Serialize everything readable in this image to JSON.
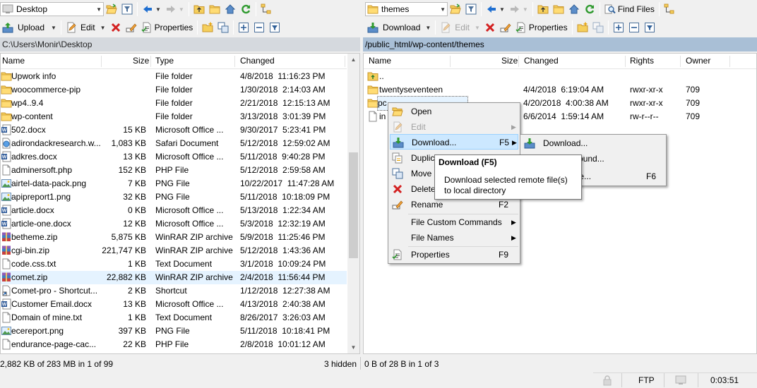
{
  "left": {
    "location": "Desktop",
    "toolbar": {
      "upload": "Upload",
      "edit": "Edit",
      "properties": "Properties"
    },
    "path": "C:\\Users\\Monir\\Desktop",
    "columns": {
      "name": "Name",
      "size": "Size",
      "type": "Type",
      "changed": "Changed"
    },
    "files": [
      {
        "icon": "folder-icon",
        "name": "Upwork info",
        "size": "",
        "type": "File folder",
        "changed": "4/8/2018  11:16:23 PM"
      },
      {
        "icon": "folder-icon",
        "name": "woocommerce-pip",
        "size": "",
        "type": "File folder",
        "changed": "1/30/2018  2:14:03 AM"
      },
      {
        "icon": "folder-icon",
        "name": "wp4..9.4",
        "size": "",
        "type": "File folder",
        "changed": "2/21/2018  12:15:13 AM"
      },
      {
        "icon": "folder-icon",
        "name": "wp-content",
        "size": "",
        "type": "File folder",
        "changed": "3/13/2018  3:01:39 PM"
      },
      {
        "icon": "word-doc-icon",
        "name": "502.docx",
        "size": "15 KB",
        "type": "Microsoft Office ...",
        "changed": "9/30/2017  5:23:41 PM"
      },
      {
        "icon": "webloc-icon",
        "name": "adirondackresearch.w...",
        "size": "1,083 KB",
        "type": "Safari Document",
        "changed": "5/12/2018  12:59:02 AM"
      },
      {
        "icon": "word-doc-icon",
        "name": "adkres.docx",
        "size": "13 KB",
        "type": "Microsoft Office ...",
        "changed": "5/11/2018  9:40:28 PM"
      },
      {
        "icon": "file-icon",
        "name": "adminersoft.php",
        "size": "152 KB",
        "type": "PHP File",
        "changed": "5/12/2018  2:59:58 AM"
      },
      {
        "icon": "image-icon",
        "name": "airtel-data-pack.png",
        "size": "7 KB",
        "type": "PNG File",
        "changed": "10/22/2017  11:47:28 AM"
      },
      {
        "icon": "image-icon",
        "name": "apipreport1.png",
        "size": "32 KB",
        "type": "PNG File",
        "changed": "5/11/2018  10:18:09 PM"
      },
      {
        "icon": "word-doc-icon",
        "name": "article.docx",
        "size": "0 KB",
        "type": "Microsoft Office ...",
        "changed": "5/13/2018  1:22:34 AM"
      },
      {
        "icon": "word-doc-icon",
        "name": "article-one.docx",
        "size": "12 KB",
        "type": "Microsoft Office ...",
        "changed": "5/3/2018  12:32:19 AM"
      },
      {
        "icon": "archive-icon",
        "name": "betheme.zip",
        "size": "5,875 KB",
        "type": "WinRAR ZIP archive",
        "changed": "5/9/2018  11:25:46 PM"
      },
      {
        "icon": "archive-icon",
        "name": "cgi-bin.zip",
        "size": "221,747 KB",
        "type": "WinRAR ZIP archive",
        "changed": "5/12/2018  1:43:36 AM"
      },
      {
        "icon": "file-icon",
        "name": "code.css.txt",
        "size": "1 KB",
        "type": "Text Document",
        "changed": "3/1/2018  10:09:24 PM"
      },
      {
        "icon": "archive-icon",
        "name": "comet.zip",
        "size": "22,882 KB",
        "type": "WinRAR ZIP archive",
        "changed": "2/4/2018  11:56:44 PM"
      },
      {
        "icon": "shortcut-icon",
        "name": "Comet-pro - Shortcut...",
        "size": "2 KB",
        "type": "Shortcut",
        "changed": "1/12/2018  12:27:38 AM"
      },
      {
        "icon": "word-doc-icon",
        "name": "Customer Email.docx",
        "size": "13 KB",
        "type": "Microsoft Office ...",
        "changed": "4/13/2018  2:40:38 AM"
      },
      {
        "icon": "file-icon",
        "name": "Domain of mine.txt",
        "size": "1 KB",
        "type": "Text Document",
        "changed": "8/26/2017  3:26:03 AM"
      },
      {
        "icon": "image-icon",
        "name": "ecereport.png",
        "size": "397 KB",
        "type": "PNG File",
        "changed": "5/11/2018  10:18:41 PM"
      },
      {
        "icon": "file-icon",
        "name": "endurance-page-cac...",
        "size": "22 KB",
        "type": "PHP File",
        "changed": "2/8/2018  10:01:12 AM"
      }
    ],
    "status": "2,882 KB of 283 MB in 1 of 99",
    "hidden": "3 hidden"
  },
  "right": {
    "location": "themes",
    "toolbar": {
      "find": "Find Files",
      "download": "Download",
      "edit": "Edit",
      "properties": "Properties"
    },
    "path": "/public_html/wp-content/themes",
    "columns": {
      "name": "Name",
      "size": "Size",
      "changed": "Changed",
      "rights": "Rights",
      "owner": "Owner"
    },
    "files": [
      {
        "icon": "parent-folder-icon",
        "name": "..",
        "size": "",
        "changed": "",
        "rights": "",
        "owner": ""
      },
      {
        "icon": "folder-icon",
        "name": "twentyseventeen",
        "size": "",
        "changed": "4/4/2018  6:19:04 AM",
        "rights": "rwxr-xr-x",
        "owner": "709"
      },
      {
        "icon": "folder-icon",
        "name": "pc",
        "size": "",
        "changed": "4/20/2018  4:00:38 AM",
        "rights": "rwxr-xr-x",
        "owner": "709"
      },
      {
        "icon": "file-icon",
        "name": "in",
        "size": "",
        "changed": "6/6/2014  1:59:14 AM",
        "rights": "rw-r--r--",
        "owner": "709"
      }
    ],
    "status": "0 B of 28 B in 1 of 3",
    "protocol": "FTP",
    "timer": "0:03:51"
  },
  "context_menu": {
    "open": "Open",
    "edit": "Edit",
    "download": "Download...",
    "download_key": "F5",
    "duplicate": "Duplic",
    "move": "Move",
    "delete": "Delete",
    "rename": "Rename",
    "rename_key": "F2",
    "custom_commands": "File Custom Commands",
    "file_names": "File Names",
    "properties": "Properties",
    "properties_key": "F9"
  },
  "submenu": {
    "download": "Download...",
    "background": "in Background...",
    "and_delete": "and Delete...",
    "and_delete_key": "F6"
  },
  "tooltip": {
    "title": "Download (F5)",
    "line1": "Download selected remote file(s)",
    "line2": "to local directory"
  },
  "colors": {
    "accent": "#a9bfd6",
    "highlight": "#cce8ff",
    "folder": "#e8b84a"
  }
}
